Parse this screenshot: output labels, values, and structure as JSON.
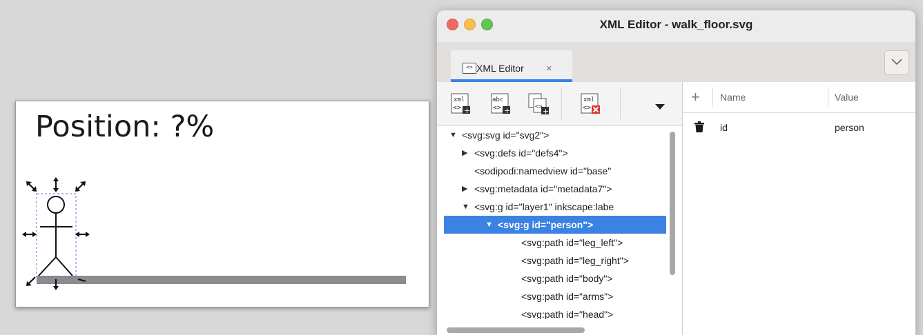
{
  "canvas": {
    "position_text": "Position: ?%"
  },
  "window": {
    "title": "XML Editor - walk_floor.svg",
    "tab": {
      "label": "XML Editor",
      "close": "×"
    }
  },
  "toolbar": {
    "new_element_icon": "xml",
    "new_text_icon": "abc",
    "delete_node_icon": "xml"
  },
  "tree": {
    "nodes": [
      {
        "label": "<svg:svg id=\"svg2\">",
        "arrow": "▼"
      },
      {
        "label": "<svg:defs id=\"defs4\">",
        "arrow": "▶"
      },
      {
        "label": "<sodipodi:namedview id=\"base\"",
        "arrow": ""
      },
      {
        "label": "<svg:metadata id=\"metadata7\">",
        "arrow": "▶"
      },
      {
        "label": "<svg:g id=\"layer1\" inkscape:labe",
        "arrow": "▼"
      },
      {
        "label": "<svg:g id=\"person\">",
        "arrow": "▼"
      },
      {
        "label": "<svg:path id=\"leg_left\">",
        "arrow": ""
      },
      {
        "label": "<svg:path id=\"leg_right\">",
        "arrow": ""
      },
      {
        "label": "<svg:path id=\"body\">",
        "arrow": ""
      },
      {
        "label": "<svg:path id=\"arms\">",
        "arrow": ""
      },
      {
        "label": "<svg:path id=\"head\">",
        "arrow": ""
      }
    ]
  },
  "attributes": {
    "add_symbol": "+",
    "columns": {
      "name": "Name",
      "value": "Value"
    },
    "rows": [
      {
        "name": "id",
        "value": "person"
      }
    ]
  },
  "colors": {
    "selection": "#3b83e2",
    "tab_accent": "#3584e4",
    "delete_red": "#e0312b"
  }
}
